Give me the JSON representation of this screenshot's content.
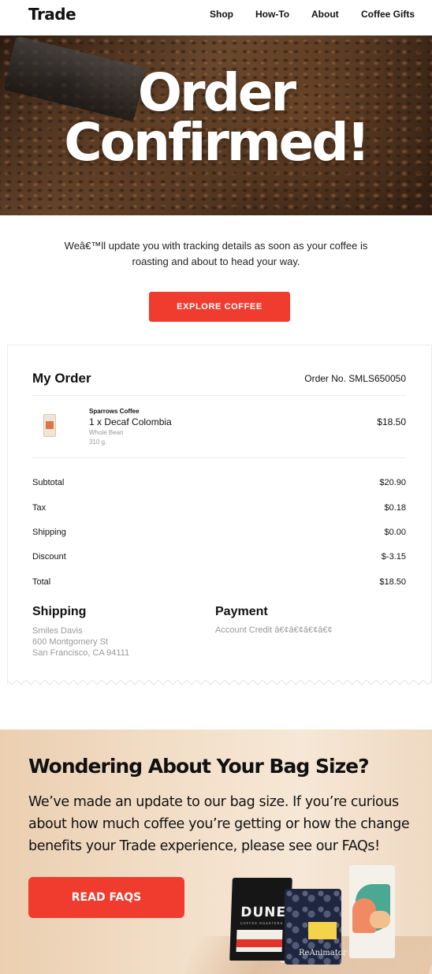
{
  "header": {
    "logo": "Trade",
    "nav": [
      "Shop",
      "How-To",
      "About",
      "Coffee Gifts"
    ]
  },
  "hero": {
    "line1": "Order",
    "line2": "Confirmed!"
  },
  "intro": {
    "text": "Weâ€™ll update you with tracking details as soon as your coffee is roasting and about to head your way.",
    "cta": "EXPLORE COFFEE"
  },
  "order": {
    "title": "My Order",
    "order_no": "Order No. SMLS650050",
    "item": {
      "brand": "Sparrows Coffee",
      "name": "1 x Decaf Colombia",
      "grind": "Whole Bean",
      "weight": "310 g.",
      "price": "$18.50"
    },
    "summary": [
      {
        "label": "Subtotal",
        "value": "$20.90"
      },
      {
        "label": "Tax",
        "value": "$0.18"
      },
      {
        "label": "Shipping",
        "value": "$0.00"
      },
      {
        "label": "Discount",
        "value": "$-3.15"
      },
      {
        "label": "Total",
        "value": "$18.50"
      }
    ],
    "shipping": {
      "title": "Shipping",
      "name": "Smiles Davis",
      "street": "600 Montgomery St",
      "city": "San Francisco, CA 94111"
    },
    "payment": {
      "title": "Payment",
      "method": "Account Credit â€¢â€¢â€¢â€¢"
    }
  },
  "promo": {
    "title": "Wondering About Your Bag Size?",
    "text": "We’ve made an update to our bag size. If you’re curious about how much coffee you’re getting or how the change benefits your Trade experience, please see our FAQs!",
    "button": "READ FAQS",
    "bag_labels": {
      "dune": "DUNE",
      "dune_sub": "COFFEE ROASTERS",
      "reanimator": "ReAnimator"
    }
  },
  "colors": {
    "accent": "#f03c2e",
    "muted_text": "#999999"
  }
}
